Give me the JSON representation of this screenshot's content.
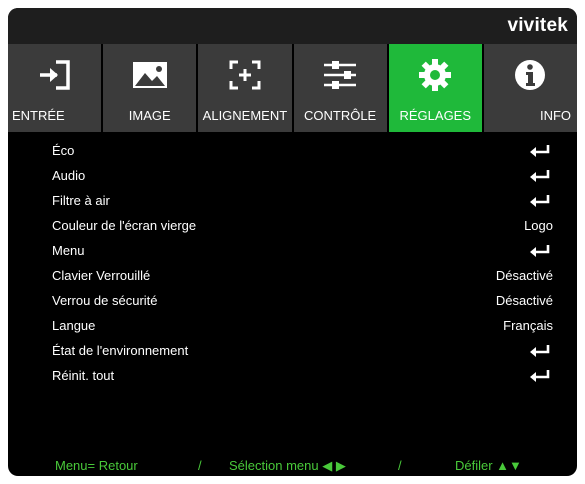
{
  "brand": "vivitek",
  "tabs": [
    {
      "label": "ENTRÉE",
      "icon": "input-icon",
      "active": false
    },
    {
      "label": "IMAGE",
      "icon": "image-icon",
      "active": false
    },
    {
      "label": "ALIGNEMENT",
      "icon": "alignment-icon",
      "active": false
    },
    {
      "label": "CONTRÔLE",
      "icon": "sliders-icon",
      "active": false
    },
    {
      "label": "RÉGLAGES",
      "icon": "gear-icon",
      "active": true
    },
    {
      "label": "INFO",
      "icon": "info-icon",
      "active": false
    }
  ],
  "menu": [
    {
      "label": "Éco",
      "value": "",
      "enter": true
    },
    {
      "label": "Audio",
      "value": "",
      "enter": true
    },
    {
      "label": "Filtre à air",
      "value": "",
      "enter": true
    },
    {
      "label": "Couleur de l'écran vierge",
      "value": "Logo",
      "enter": false
    },
    {
      "label": "Menu",
      "value": "",
      "enter": true
    },
    {
      "label": "Clavier Verrouillé",
      "value": "Désactivé",
      "enter": false
    },
    {
      "label": "Verrou de sécurité",
      "value": "Désactivé",
      "enter": false
    },
    {
      "label": "Langue",
      "value": "Français",
      "enter": false
    },
    {
      "label": "État de l'environnement",
      "value": "",
      "enter": true
    },
    {
      "label": "Réinit. tout",
      "value": "",
      "enter": true
    }
  ],
  "footer": {
    "menu_hint": "Menu= Retour",
    "sep1": "/",
    "select_hint": "Sélection menu ◀ ▶",
    "sep2": "/",
    "scroll_hint": "Défiler ▲▼"
  },
  "colors": {
    "background": "#000000",
    "tab": "#3b3b3b",
    "tab_active": "#1fb93a",
    "footer_text": "#49c93a"
  }
}
